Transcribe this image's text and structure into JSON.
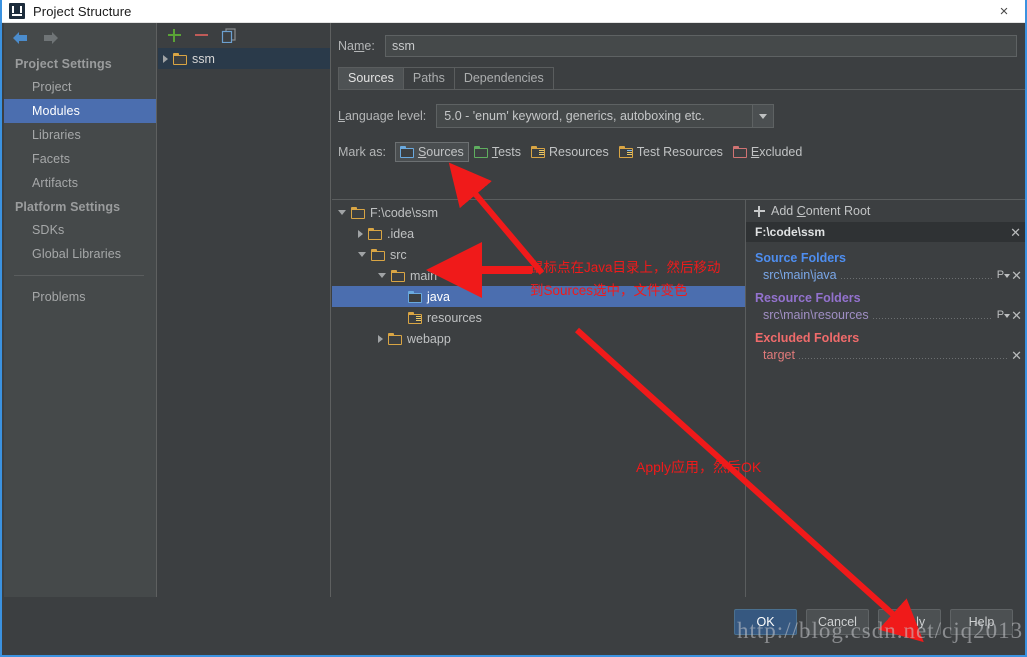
{
  "window": {
    "title": "Project Structure",
    "icon": "intellij-idea-logo-icon",
    "close_label": "×"
  },
  "sidebar": {
    "nav": {
      "back": "back-arrow-icon",
      "forward": "forward-arrow-icon"
    },
    "groups": [
      {
        "label": "Project Settings",
        "items": [
          {
            "label": "Project",
            "selected": false
          },
          {
            "label": "Modules",
            "selected": true
          },
          {
            "label": "Libraries",
            "selected": false
          },
          {
            "label": "Facets",
            "selected": false
          },
          {
            "label": "Artifacts",
            "selected": false
          }
        ]
      },
      {
        "label": "Platform Settings",
        "items": [
          {
            "label": "SDKs",
            "selected": false
          },
          {
            "label": "Global Libraries",
            "selected": false
          }
        ]
      }
    ],
    "problems_label": "Problems"
  },
  "modules_panel": {
    "toolbar": [
      {
        "name": "add-module-button",
        "glyph": "+"
      },
      {
        "name": "remove-module-button",
        "glyph": "−"
      },
      {
        "name": "copy-module-button",
        "glyph": "copy-icon"
      }
    ],
    "rows": [
      {
        "label": "ssm",
        "expanded": false,
        "selected": true
      }
    ]
  },
  "main": {
    "name_label": "Name:",
    "name_value": "ssm",
    "tabs": [
      {
        "label": "Sources",
        "active": true
      },
      {
        "label": "Paths",
        "active": false
      },
      {
        "label": "Dependencies",
        "active": false
      }
    ],
    "language_level_label": "Language level:",
    "language_level_value": "5.0 - 'enum' keyword, generics, autoboxing etc.",
    "mark_as_label": "Mark as:",
    "mark_as_options": [
      {
        "label": "Sources",
        "color": "blue",
        "active": true
      },
      {
        "label": "Tests",
        "color": "green",
        "active": false
      },
      {
        "label": "Resources",
        "color": "orange",
        "active": false
      },
      {
        "label": "Test Resources",
        "color": "orange",
        "active": false
      },
      {
        "label": "Excluded",
        "color": "red",
        "active": false
      }
    ],
    "tree": [
      {
        "label": "F:\\code\\ssm",
        "indent": 0,
        "arrow": "down",
        "icon": "folder-plain",
        "selected": false
      },
      {
        "label": ".idea",
        "indent": 1,
        "arrow": "right",
        "icon": "folder-plain",
        "selected": false
      },
      {
        "label": "src",
        "indent": 1,
        "arrow": "down",
        "icon": "folder-plain",
        "selected": false
      },
      {
        "label": "main",
        "indent": 2,
        "arrow": "down",
        "icon": "folder-plain",
        "selected": false
      },
      {
        "label": "java",
        "indent": 3,
        "arrow": "none",
        "icon": "folder-sources",
        "selected": true
      },
      {
        "label": "resources",
        "indent": 3,
        "arrow": "none",
        "icon": "folder-resources",
        "selected": false
      },
      {
        "label": "webapp",
        "indent": 2,
        "arrow": "right",
        "icon": "folder-plain",
        "selected": false
      }
    ],
    "roots": {
      "add_content_root_label": "Add Content Root",
      "content_root_path": "F:\\code\\ssm",
      "sections": [
        {
          "title": "Source Folders",
          "kind": "src",
          "items": [
            {
              "path": "src\\main\\java",
              "prefix_button": "P"
            }
          ]
        },
        {
          "title": "Resource Folders",
          "kind": "res",
          "items": [
            {
              "path": "src\\main\\resources",
              "prefix_button": "P"
            }
          ]
        },
        {
          "title": "Excluded Folders",
          "kind": "exc",
          "items": [
            {
              "path": "target",
              "prefix_button": ""
            }
          ]
        }
      ]
    }
  },
  "footer": {
    "buttons": [
      {
        "label": "OK",
        "primary": true
      },
      {
        "label": "Cancel",
        "primary": false
      },
      {
        "label": "Apply",
        "primary": false
      },
      {
        "label": "Help",
        "primary": false
      }
    ]
  },
  "annotations": {
    "note_tree_line1": "鼠标点在Java目录上，然后移动",
    "note_tree_line2": "到Sources选中，文件变色",
    "note_apply": "Apply应用，然后OK",
    "arrow_color": "#f01a1a"
  },
  "watermark": {
    "text": "http://blog.csdn.net/cjq2013"
  }
}
